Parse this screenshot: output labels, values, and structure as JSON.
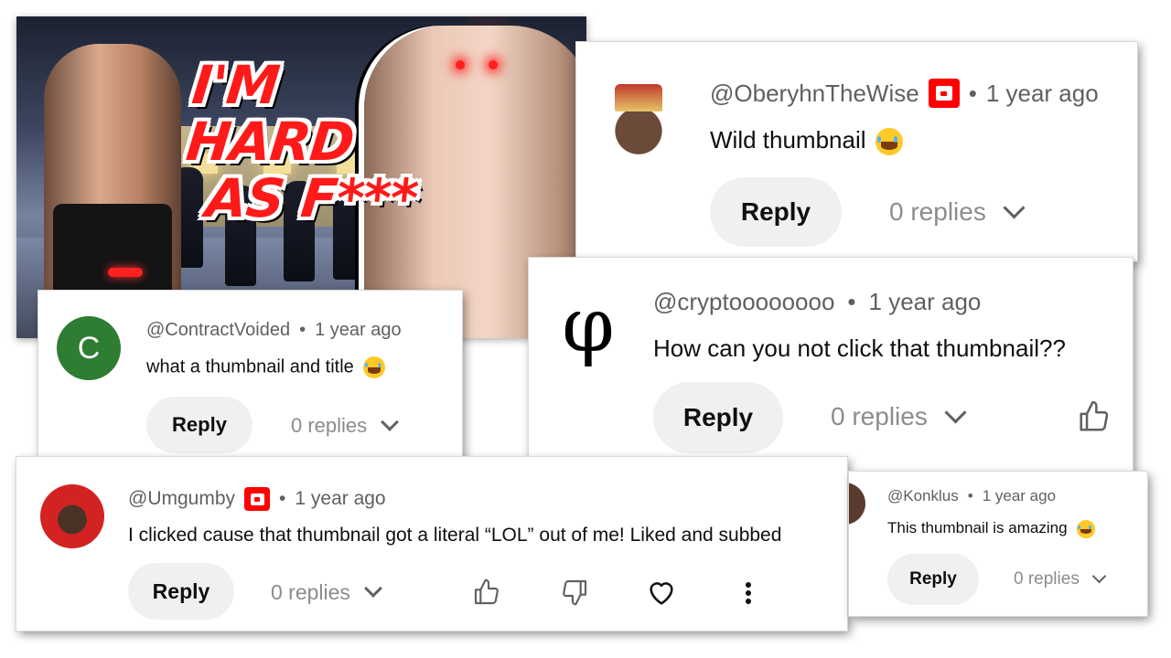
{
  "thumbnail": {
    "headline_line1": "I'M HARD",
    "headline_line2": "AS F***"
  },
  "comments": [
    {
      "id": "oberyhn",
      "handle": "@OberyhnTheWise",
      "has_member_badge": true,
      "time": "1 year ago",
      "text": "Wild thumbnail",
      "emoji": "laughing-tears",
      "reply_label": "Reply",
      "replies_label": "0 replies"
    },
    {
      "id": "contractvoided",
      "handle": "@ContractVoided",
      "avatar_letter": "C",
      "avatar_color": "#2e7d32",
      "time": "1 year ago",
      "text": "what a thumbnail and title",
      "emoji": "laughing-tears",
      "reply_label": "Reply",
      "replies_label": "0 replies"
    },
    {
      "id": "crypto",
      "handle": "@cryptoooooooo",
      "avatar_symbol": "φ",
      "time": "1 year ago",
      "text": "How can you not click that thumbnail??",
      "reply_label": "Reply",
      "replies_label": "0 replies"
    },
    {
      "id": "umgumby",
      "handle": "@Umgumby",
      "has_member_badge": true,
      "time": "1 year ago",
      "text": "I clicked cause that thumbnail got a literal “LOL” out of me! Liked and subbed",
      "reply_label": "Reply",
      "replies_label": "0 replies"
    },
    {
      "id": "konklus",
      "handle": "@Konklus",
      "time": "1 year ago",
      "text": "This thumbnail is amazing",
      "emoji": "laughing-tears",
      "reply_label": "Reply",
      "replies_label": "0 replies"
    }
  ],
  "separator": "•",
  "colors": {
    "youtube_red": "#ff0000",
    "headline_red": "#ff1a1a",
    "reply_bg": "#f0f0f0",
    "meta_gray": "#606060"
  }
}
